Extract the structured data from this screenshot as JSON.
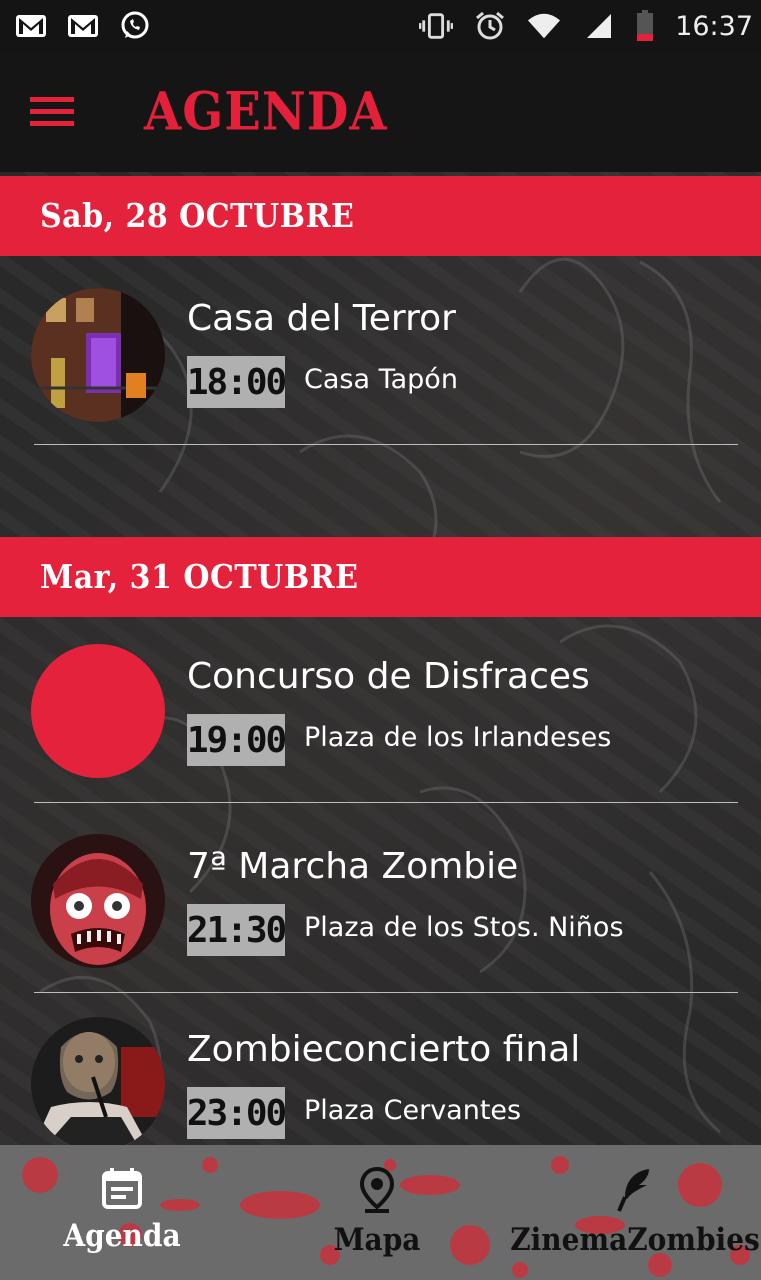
{
  "status_bar": {
    "left_icons": [
      "gmail-icon",
      "gmail-icon",
      "whatsapp-icon"
    ],
    "right_icons": [
      "vibrate-icon",
      "alarm-icon",
      "wifi-icon",
      "signal-icon",
      "battery-icon"
    ],
    "time": "16:37"
  },
  "app_bar": {
    "title": "AGENDA",
    "menu_icon": "menu-icon"
  },
  "colors": {
    "accent": "#e4223c",
    "app_bar_bg": "#151515",
    "time_badge_bg": "#b0b0b0"
  },
  "agenda": {
    "days": [
      {
        "label": "Sab, 28 OCTUBRE",
        "events": [
          {
            "title": "Casa del Terror",
            "time": "18:00",
            "place": "Casa Tapón",
            "thumb": "photo"
          }
        ]
      },
      {
        "label": "Mar, 31 OCTUBRE",
        "events": [
          {
            "title": "Concurso de Disfraces",
            "time": "19:00",
            "place": "Plaza de los Irlandeses",
            "thumb": "red-circle"
          },
          {
            "title": "7ª Marcha Zombie",
            "time": "21:30",
            "place": "Plaza de los Stos. Niños",
            "thumb": "zombie-illustration"
          },
          {
            "title": "Zombieconcierto final",
            "time": "23:00",
            "place": "Plaza Cervantes",
            "thumb": "photo"
          }
        ]
      }
    ]
  },
  "bottom_nav": {
    "items": [
      {
        "label": "Agenda",
        "icon": "calendar-icon",
        "active": true
      },
      {
        "label": "Mapa",
        "icon": "map-pin-icon",
        "active": false
      },
      {
        "label": "ZinemaZombies",
        "icon": "feather-icon",
        "active": false
      }
    ]
  }
}
